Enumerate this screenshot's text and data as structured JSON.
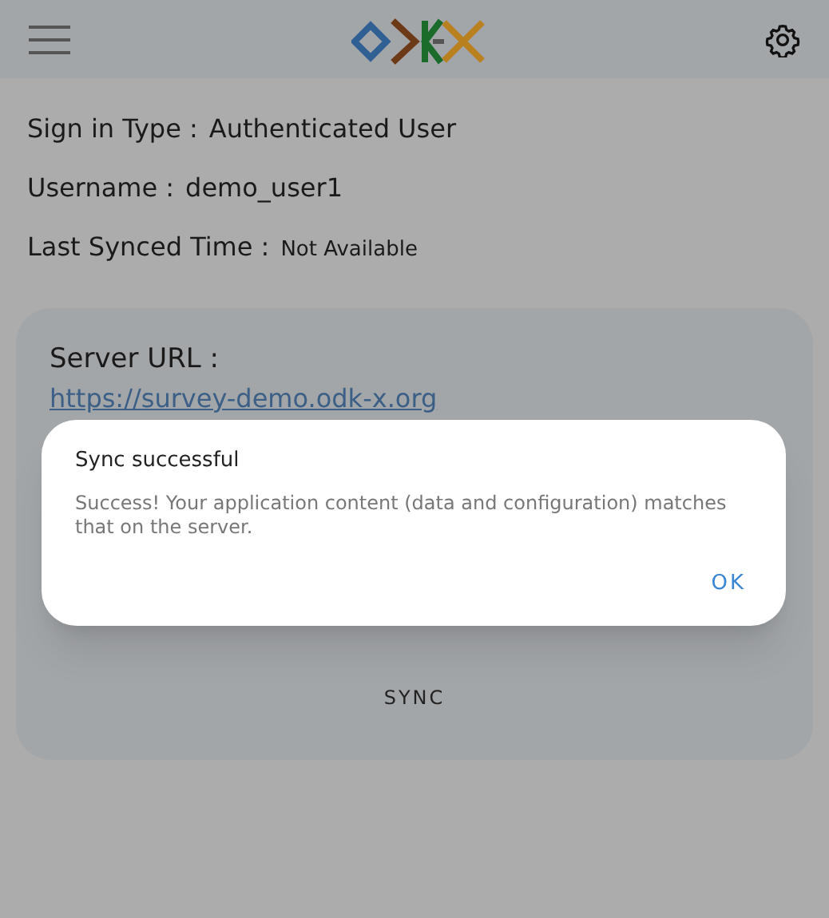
{
  "info_rows": [
    {
      "label": "Sign in Type :",
      "value": "Authenticated User"
    },
    {
      "label": "Username :",
      "value": "demo_user1"
    },
    {
      "label": "Last Synced Time :",
      "value": "Not Available"
    }
  ],
  "server": {
    "label": "Server URL :",
    "url": "https://survey-demo.odk-x.org",
    "button": "SYNC"
  },
  "dialog": {
    "title": "Sync successful",
    "message": "Success! Your application content (data and configuration) matches that on the server.",
    "button": "OK"
  }
}
